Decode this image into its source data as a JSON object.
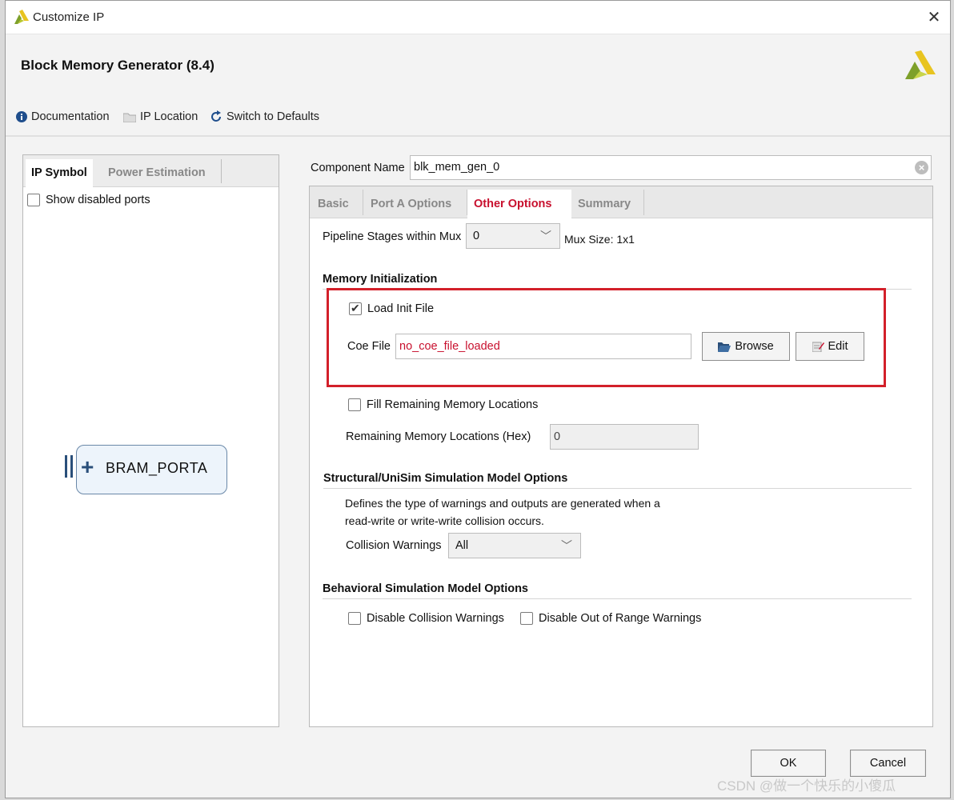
{
  "window": {
    "title": "Customize IP",
    "heading": "Block Memory Generator (8.4)"
  },
  "toolbar": {
    "documentation": "Documentation",
    "ip_location": "IP Location",
    "switch_defaults": "Switch to Defaults"
  },
  "left_panel": {
    "tabs": [
      "IP Symbol",
      "Power Estimation"
    ],
    "show_disabled_ports": "Show disabled ports",
    "show_disabled_checked": false,
    "port_label": "BRAM_PORTA"
  },
  "component": {
    "label": "Component Name",
    "value": "blk_mem_gen_0"
  },
  "tabs": [
    "Basic",
    "Port A Options",
    "Other Options",
    "Summary"
  ],
  "active_tab": "Other Options",
  "other_options": {
    "pipeline_label": "Pipeline Stages within Mux",
    "pipeline_value": "0",
    "mux_size": "Mux Size: 1x1",
    "memory_init_title": "Memory Initialization",
    "load_init_file": "Load Init File",
    "load_init_checked": true,
    "coe_label": "Coe File",
    "coe_value": "no_coe_file_loaded",
    "browse": "Browse",
    "edit": "Edit",
    "fill_remaining": "Fill Remaining Memory Locations",
    "fill_remaining_checked": false,
    "remaining_label": "Remaining Memory Locations (Hex)",
    "remaining_value": "0",
    "struct_title": "Structural/UniSim Simulation Model Options",
    "struct_desc_1": "Defines the type of warnings and outputs are generated when a",
    "struct_desc_2": "read-write or write-write collision occurs.",
    "collision_label": "Collision Warnings",
    "collision_value": "All",
    "behav_title": "Behavioral Simulation Model Options",
    "disable_collision": "Disable Collision Warnings",
    "disable_out_of_range": "Disable Out of Range Warnings"
  },
  "footer": {
    "ok": "OK",
    "cancel": "Cancel"
  },
  "watermark": "CSDN @做一个快乐的小傻瓜",
  "colors": {
    "accent_red": "#c8102e",
    "highlight_box": "#d3202a",
    "coe_text": "#c8102e",
    "info_icon": "#1f4e8c"
  }
}
